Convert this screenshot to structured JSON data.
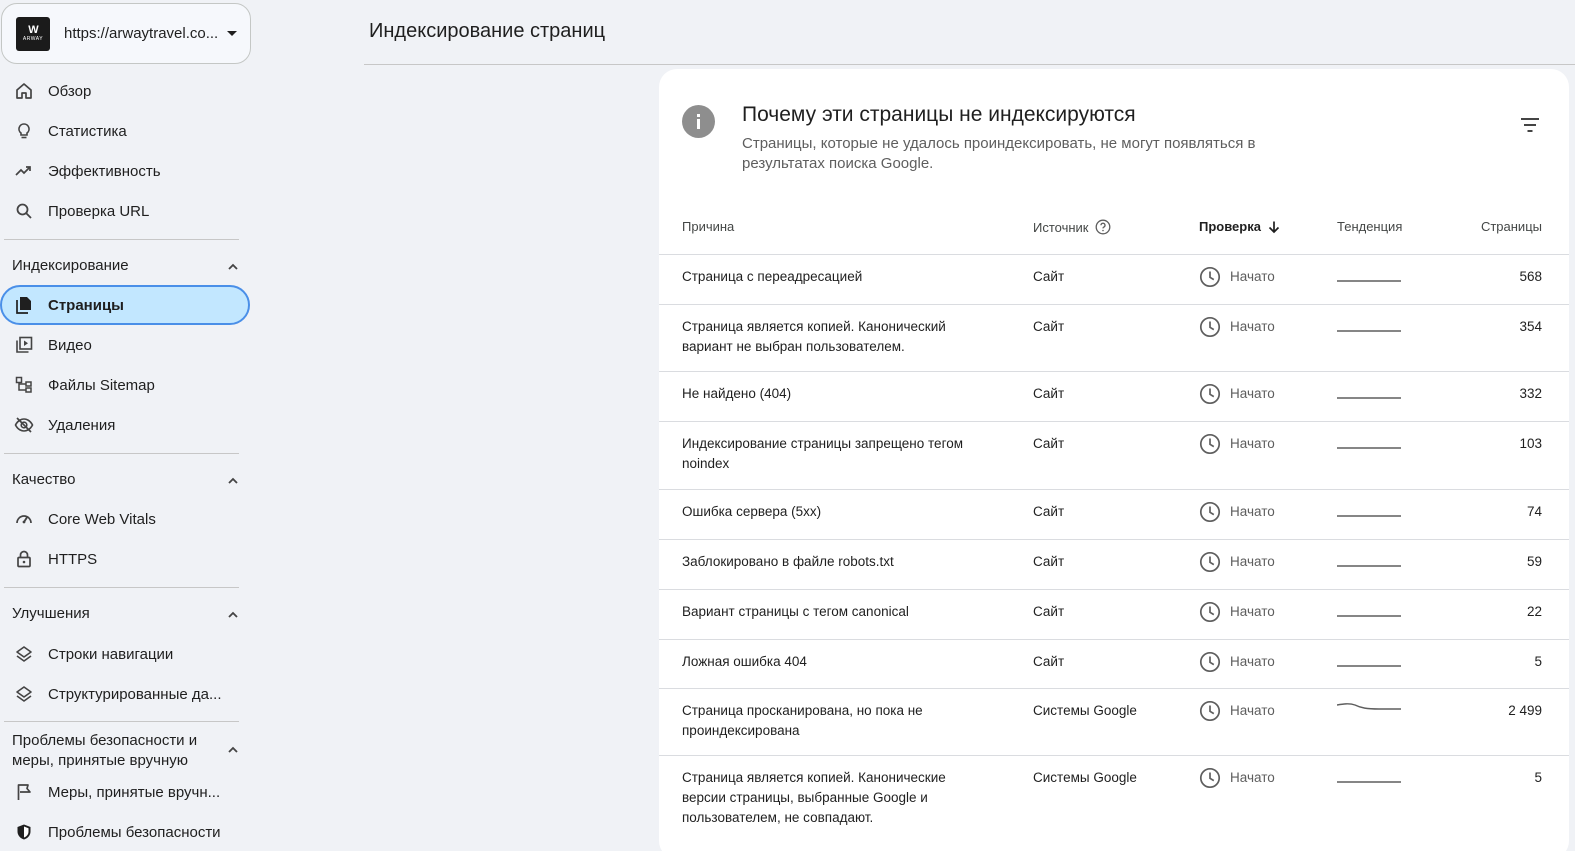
{
  "property": {
    "url": "https://arwaytravel.co...",
    "logo_text": "W",
    "logo_subtext": "ARWAY"
  },
  "nav": {
    "overview": "Обзор",
    "insights": "Статистика",
    "performance": "Эффективность",
    "url_inspection": "Проверка URL",
    "indexing_section": "Индексирование",
    "pages": "Страницы",
    "video": "Видео",
    "sitemaps": "Файлы Sitemap",
    "removals": "Удаления",
    "quality_section": "Качество",
    "core_web_vitals": "Core Web Vitals",
    "https": "HTTPS",
    "enhancements_section": "Улучшения",
    "breadcrumbs": "Строки навигации",
    "structured_data": "Структурированные да...",
    "security_section": "Проблемы безопасности и меры, принятые вручную",
    "manual_actions": "Меры, принятые вручн...",
    "security_issues": "Проблемы безопасности"
  },
  "header": {
    "title": "Индексирование страниц"
  },
  "card": {
    "title": "Почему эти страницы не индексируются",
    "subtitle": "Страницы, которые не удалось проиндексировать, не могут появляться в результатах поиска Google."
  },
  "table": {
    "headers": {
      "reason": "Причина",
      "source": "Источник",
      "validation": "Проверка",
      "trend": "Тенденция",
      "pages": "Страницы"
    },
    "rows": [
      {
        "reason": "Страница с переадресацией",
        "source": "Сайт",
        "status": "Начато",
        "pages": "568"
      },
      {
        "reason": "Страница является копией. Канонический вариант не выбран пользователем.",
        "source": "Сайт",
        "status": "Начато",
        "pages": "354"
      },
      {
        "reason": "Не найдено (404)",
        "source": "Сайт",
        "status": "Начато",
        "pages": "332"
      },
      {
        "reason": "Индексирование страницы запрещено тегом noindex",
        "source": "Сайт",
        "status": "Начато",
        "pages": "103"
      },
      {
        "reason": "Ошибка сервера (5xx)",
        "source": "Сайт",
        "status": "Начато",
        "pages": "74"
      },
      {
        "reason": "Заблокировано в файле robots.txt",
        "source": "Сайт",
        "status": "Начато",
        "pages": "59"
      },
      {
        "reason": "Вариант страницы с тегом canonical",
        "source": "Сайт",
        "status": "Начато",
        "pages": "22"
      },
      {
        "reason": "Ложная ошибка 404",
        "source": "Сайт",
        "status": "Начато",
        "pages": "5"
      },
      {
        "reason": "Страница просканирована, но пока не проиндексирована",
        "source": "Системы Google",
        "status": "Начато",
        "pages": "2 499"
      },
      {
        "reason": "Страница является копией. Канонические версии страницы, выбранные Google и пользователем, не совпадают.",
        "source": "Системы Google",
        "status": "Начато",
        "pages": "5"
      }
    ]
  },
  "colors": {
    "accent_active_bg": "#c2e7ff",
    "accent_active_border": "#4a8fe8",
    "page_bg": "#f0f2f6",
    "card_bg": "#ffffff"
  }
}
